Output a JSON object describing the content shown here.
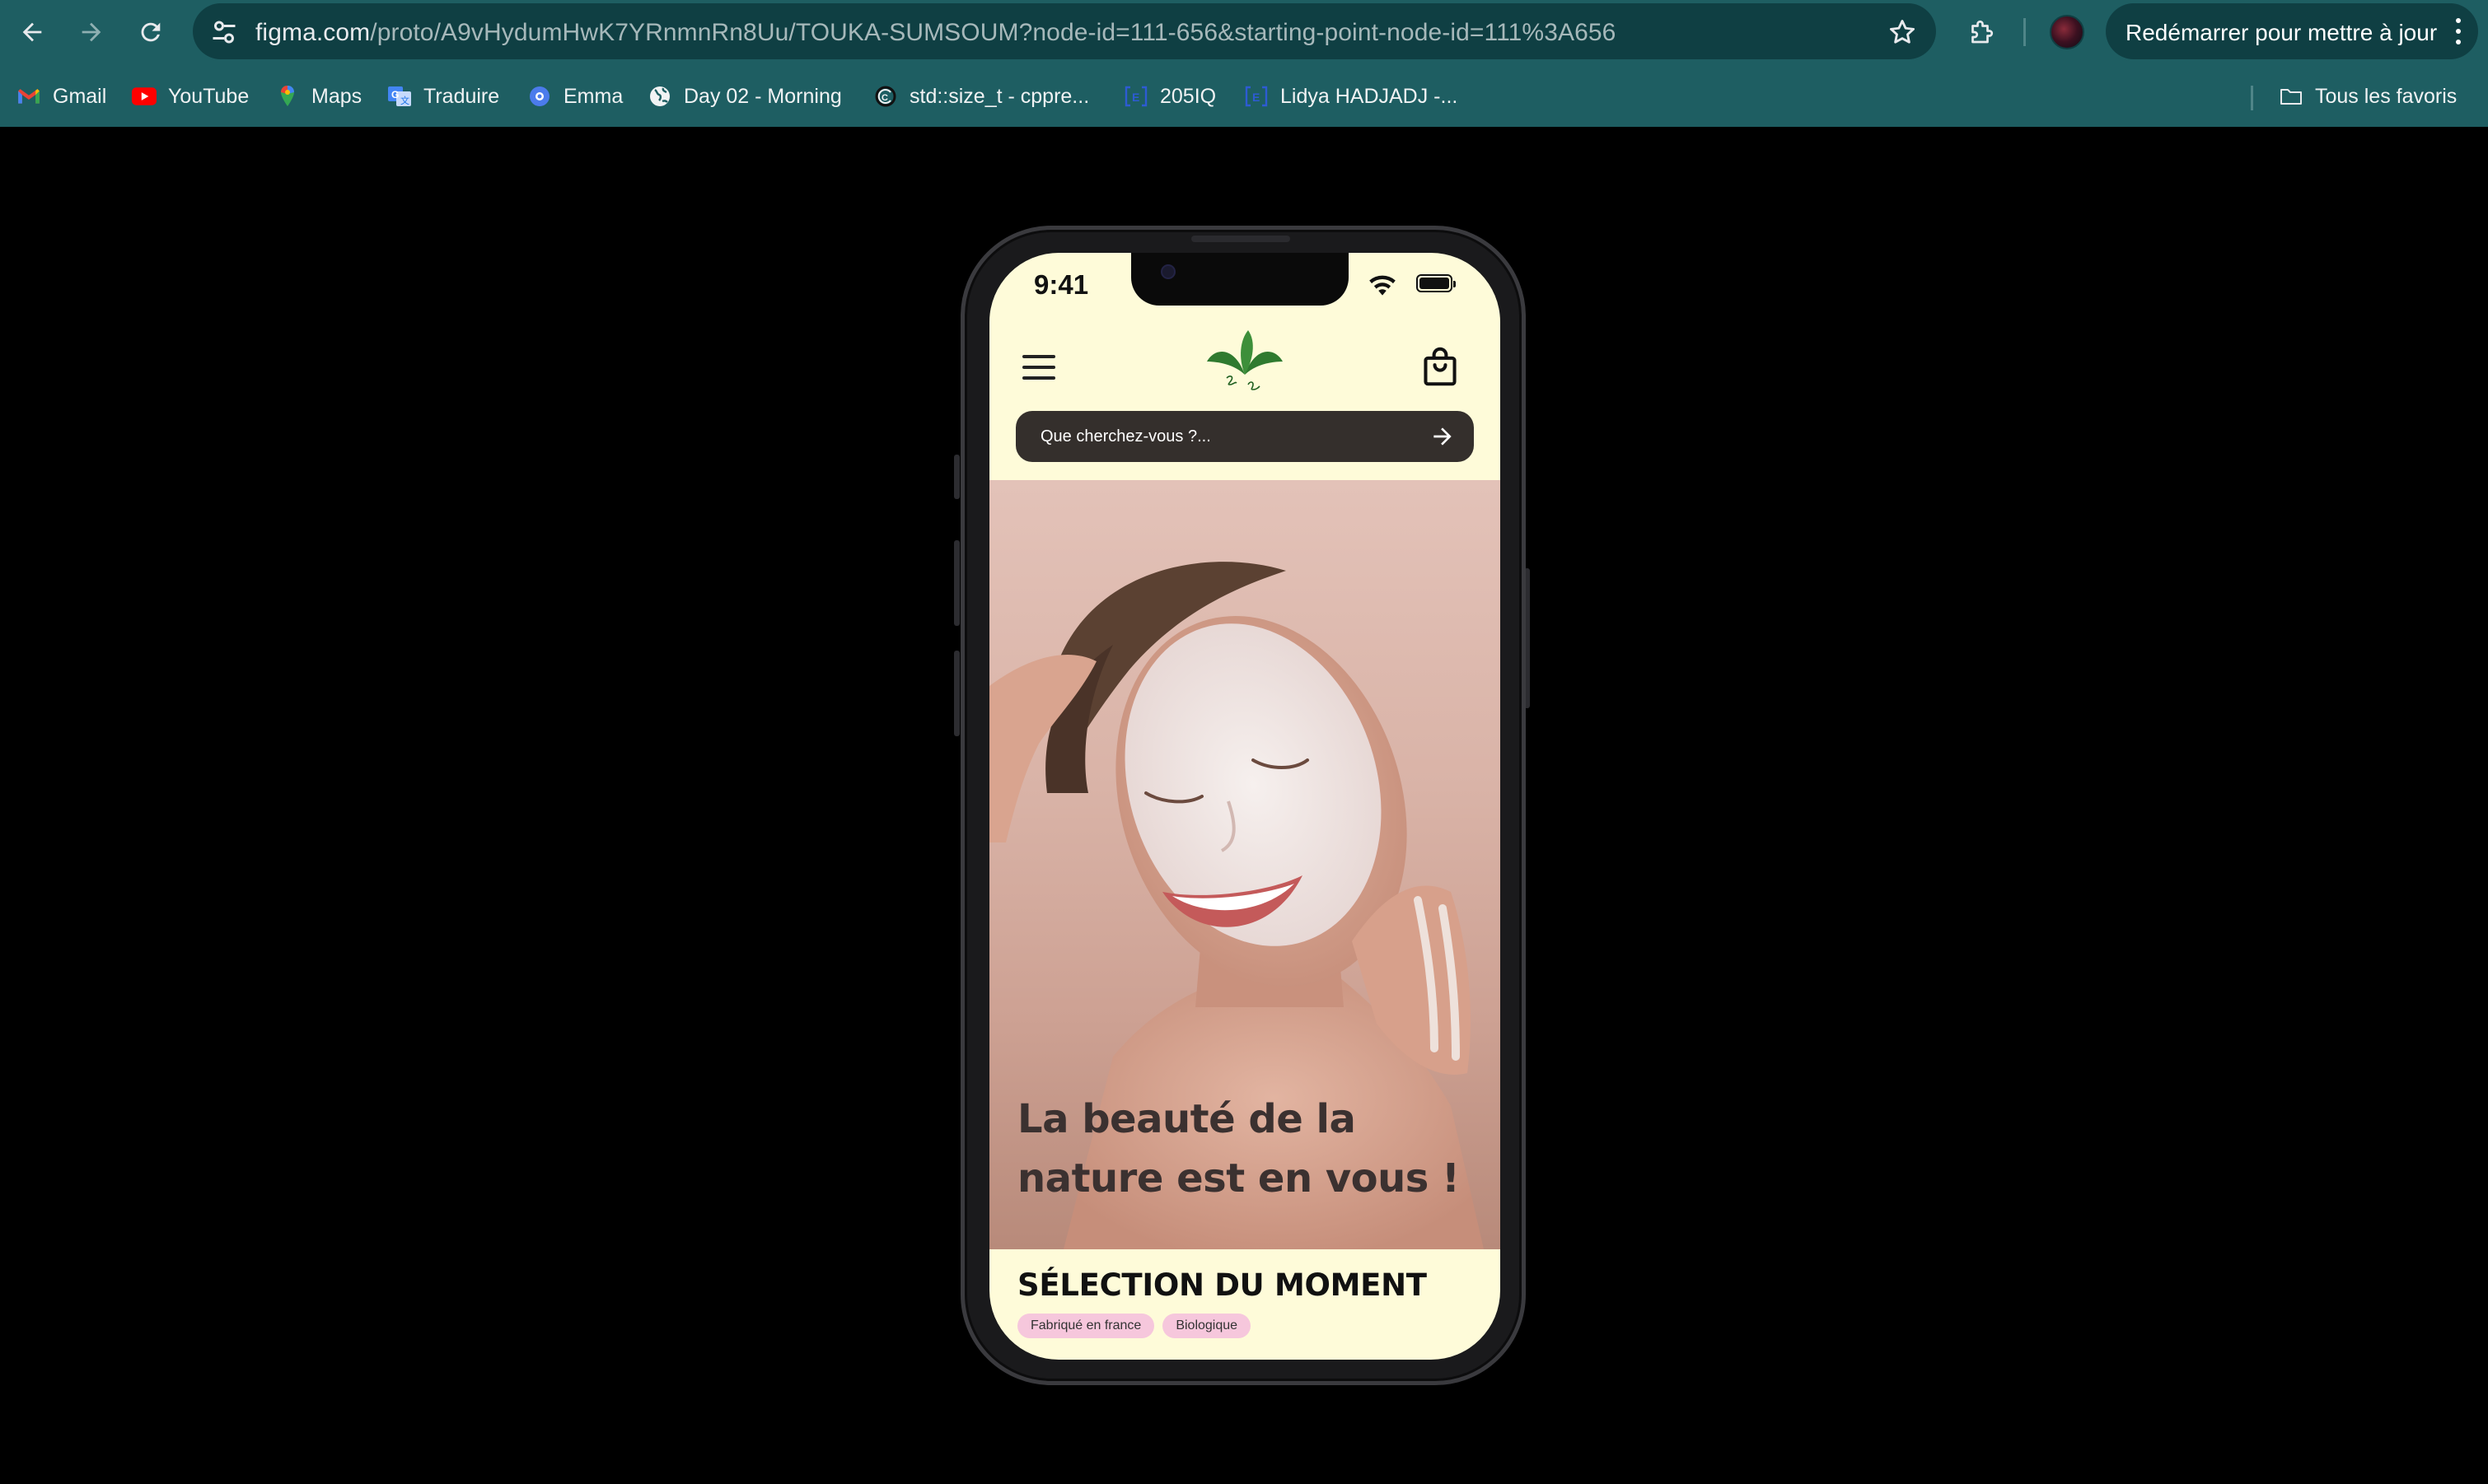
{
  "browser": {
    "url_host": "figma.com",
    "url_rest": "/proto/A9vHydumHwK7YRnmnRn8Uu/TOUKA-SUMSOUM?node-id=111-656&starting-point-node-id=111%3A656",
    "update_button": "Redémarrer pour mettre à jour",
    "bookmarks": [
      {
        "label": "Gmail",
        "icon": "gmail-icon"
      },
      {
        "label": "YouTube",
        "icon": "youtube-icon"
      },
      {
        "label": "Maps",
        "icon": "maps-icon"
      },
      {
        "label": "Traduire",
        "icon": "translate-icon"
      },
      {
        "label": "Emma",
        "icon": "emma-icon"
      },
      {
        "label": "Day 02 - Morning",
        "icon": "globe-icon"
      },
      {
        "label": "std::size_t - cppre...",
        "icon": "cppreference-icon"
      },
      {
        "label": "205IQ",
        "icon": "epitech-icon"
      },
      {
        "label": "Lidya HADJADJ -...",
        "icon": "epitech-icon"
      }
    ],
    "all_bookmarks": "Tous les favoris"
  },
  "phone": {
    "status": {
      "time": "9:41"
    },
    "search": {
      "placeholder": "Que cherchez-vous ?..."
    },
    "hero": {
      "headline": "La beauté de la nature est en vous !"
    },
    "section": {
      "title": "SÉLECTION DU MOMENT",
      "tags": [
        "Fabriqué en france",
        "Biologique"
      ]
    }
  },
  "colors": {
    "chrome": "#1e5e62",
    "omnibox": "#0f3f43",
    "app_background": "#fefbd9",
    "search_bar": "#342f2c",
    "tag": "#f6c7dc",
    "logo_green": "#2f7a2f"
  }
}
